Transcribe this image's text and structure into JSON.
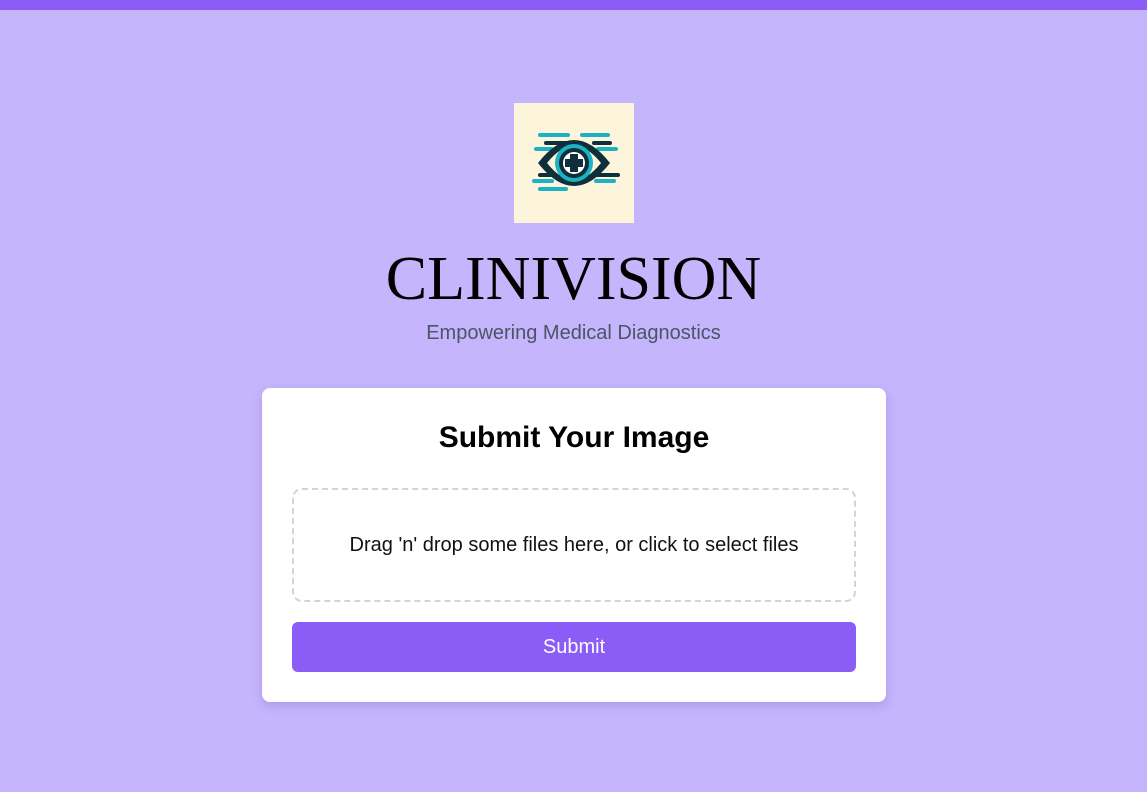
{
  "app": {
    "name": "CLINIVISION",
    "tagline": "Empowering Medical Diagnostics",
    "logo_icon": "eye-medical-cross-icon"
  },
  "upload_card": {
    "title": "Submit Your Image",
    "dropzone_text": "Drag 'n' drop some files here, or click to select files",
    "submit_label": "Submit"
  },
  "colors": {
    "background": "#c4b5fd",
    "accent": "#8b5cf6",
    "logo_background": "#fdf4dc",
    "logo_dark": "#0f2f3a",
    "logo_teal": "#1bb3c3"
  }
}
